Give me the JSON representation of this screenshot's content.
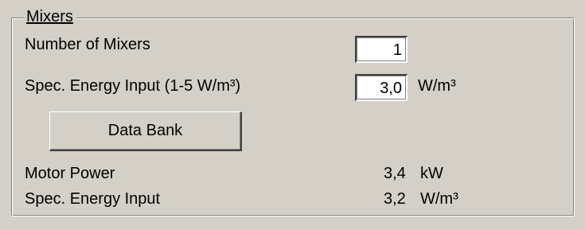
{
  "group": {
    "title": "Mixers"
  },
  "fields": {
    "mixers_count_label": "Number of Mixers",
    "mixers_count_value": "1",
    "spec_energy_label": "Spec. Energy Input (1-5 W/m³)",
    "spec_energy_value": "3,0",
    "spec_energy_unit": "W/m³"
  },
  "buttons": {
    "data_bank": "Data Bank"
  },
  "results": {
    "motor_power_label": "Motor Power",
    "motor_power_value": "3,4",
    "motor_power_unit": "kW",
    "spec_energy_input_label": "Spec. Energy Input",
    "spec_energy_input_value": "3,2",
    "spec_energy_input_unit": "W/m³"
  }
}
